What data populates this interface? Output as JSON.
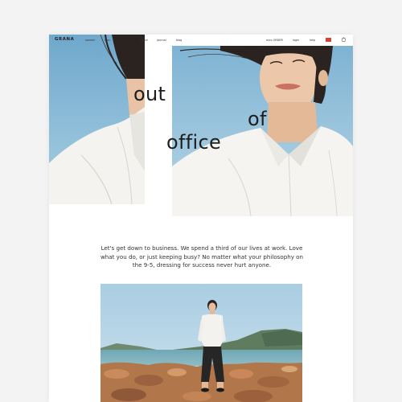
{
  "brand": {
    "logo": "GRANA"
  },
  "nav": {
    "left": [
      "women",
      "men",
      "about",
      "journal",
      "blog"
    ],
    "right": [
      "euro ORDER",
      "login",
      "help"
    ]
  },
  "hero": {
    "word1": "out",
    "word2": "of",
    "word3": "office"
  },
  "intro": {
    "text": "Let's get down to business. We spend a third of our lives at work. Love what you do, or just keeping busy? No matter what your philosophy on the 9-5, dressing for success never hurt anyone."
  },
  "colors": {
    "flag": "#d9402e",
    "sky": "#8dbcd6",
    "text": "#1e1e1e"
  },
  "icons": [
    "cart-icon",
    "flag-icon"
  ]
}
